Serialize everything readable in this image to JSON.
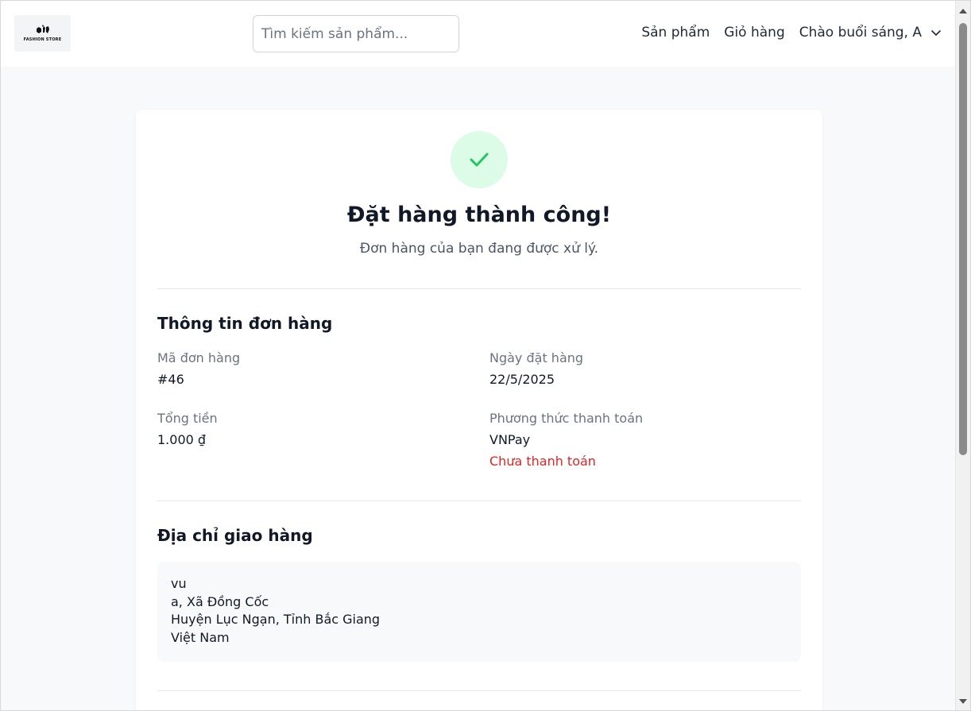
{
  "header": {
    "logo_text": "FASHION STORE",
    "search_placeholder": "Tìm kiếm sản phẩm...",
    "nav": {
      "products": "Sản phẩm",
      "cart": "Giỏ hàng",
      "greeting": "Chào buổi sáng, A"
    }
  },
  "success": {
    "icon": "check-icon",
    "title": "Đặt hàng thành công!",
    "subtitle": "Đơn hàng của bạn đang được xử lý."
  },
  "order_info": {
    "section_title": "Thông tin đơn hàng",
    "order_id_label": "Mã đơn hàng",
    "order_id": "#46",
    "order_date_label": "Ngày đặt hàng",
    "order_date": "22/5/2025",
    "total_label": "Tổng tiền",
    "total": "1.000 ₫",
    "payment_method_label": "Phương thức thanh toán",
    "payment_method": "VNPay",
    "payment_status": "Chưa thanh toán"
  },
  "shipping": {
    "section_title": "Địa chỉ giao hàng",
    "lines": [
      "vu",
      "a, Xã Đồng Cốc",
      "Huyện Lục Ngạn, Tỉnh Bắc Giang",
      "Việt Nam"
    ]
  },
  "colors": {
    "accent_success": "#22c55e",
    "success_bg": "#dcfce7",
    "unpaid": "#dc2626"
  }
}
